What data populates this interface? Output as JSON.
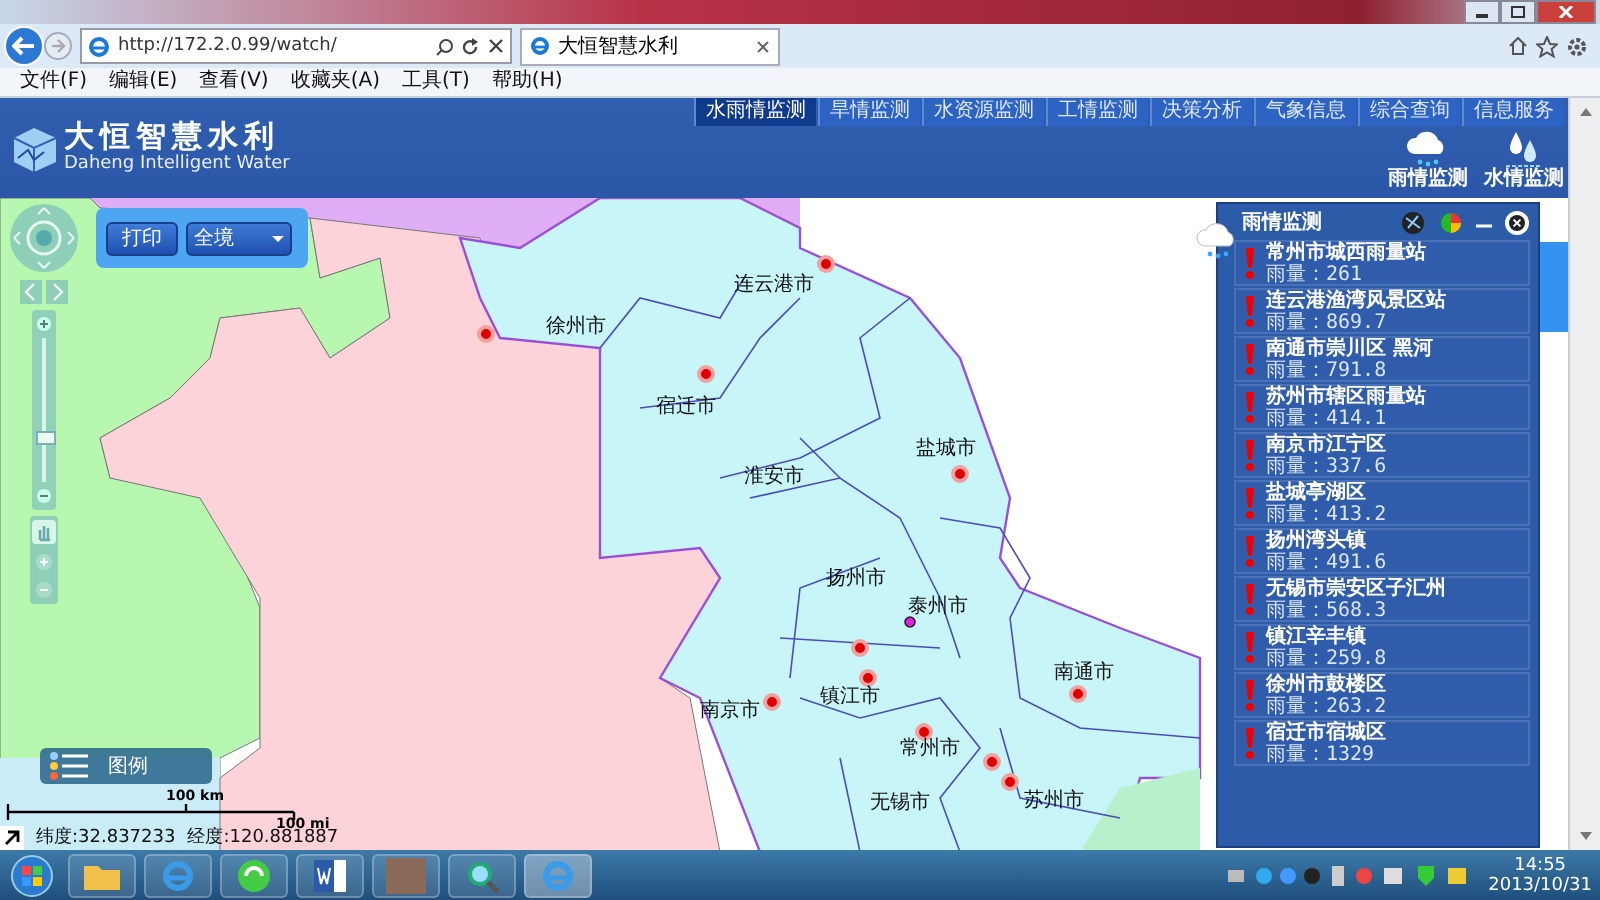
{
  "browser": {
    "url": "http://172.2.0.99/watch/",
    "tab_title": "大恒智慧水利",
    "menu": [
      "文件(F)",
      "编辑(E)",
      "查看(V)",
      "收藏夹(A)",
      "工具(T)",
      "帮助(H)"
    ]
  },
  "header": {
    "title": "大恒智慧水利",
    "subtitle": "Daheng Intelligent Water",
    "nav": [
      {
        "label": "水雨情监测",
        "selected": true
      },
      {
        "label": "旱情监测",
        "selected": false
      },
      {
        "label": "水资源监测",
        "selected": false
      },
      {
        "label": "工情监测",
        "selected": false
      },
      {
        "label": "决策分析",
        "selected": false
      },
      {
        "label": "气象信息",
        "selected": false
      },
      {
        "label": "综合查询",
        "selected": false
      },
      {
        "label": "信息服务",
        "selected": false
      }
    ],
    "quick": [
      {
        "kind": "rain",
        "label": "雨情监测"
      },
      {
        "kind": "water",
        "label": "水情监测"
      }
    ]
  },
  "map": {
    "print_button": "打印",
    "extent_select": "全境",
    "zoom": {
      "level": 0.3
    },
    "legend": "图例",
    "scale": {
      "km": "100 km",
      "mi": "100 mi"
    },
    "latitude": "纬度:32.837233",
    "longitude": "经度:120.881887",
    "cities": [
      "徐州市",
      "连云港市",
      "宿迁市",
      "淮安市",
      "盐城市",
      "扬州市",
      "泰州市",
      "南通市",
      "镇江市",
      "南京市",
      "常州市",
      "无锡市",
      "苏州市"
    ]
  },
  "panel": {
    "title": "雨情监测",
    "stations": [
      {
        "name": "常州市城西雨量站",
        "reading": "雨量：261"
      },
      {
        "name": "连云港渔湾风景区站",
        "reading": "雨量：869.7"
      },
      {
        "name": "南通市崇川区 黑河",
        "reading": "雨量：791.8"
      },
      {
        "name": "苏州市辖区雨量站",
        "reading": "雨量：414.1"
      },
      {
        "name": "南京市江宁区",
        "reading": "雨量：337.6"
      },
      {
        "name": "盐城亭湖区",
        "reading": "雨量：413.2"
      },
      {
        "name": "扬州湾头镇",
        "reading": "雨量：491.6"
      },
      {
        "name": "无锡市崇安区子汇州",
        "reading": "雨量：568.3"
      },
      {
        "name": "镇江辛丰镇",
        "reading": "雨量：259.8"
      },
      {
        "name": "徐州市鼓楼区",
        "reading": "雨量：263.2"
      },
      {
        "name": "宿迁市宿城区",
        "reading": "雨量：1329"
      }
    ]
  },
  "taskbar": {
    "time": "14:55",
    "date": "2013/10/31"
  }
}
